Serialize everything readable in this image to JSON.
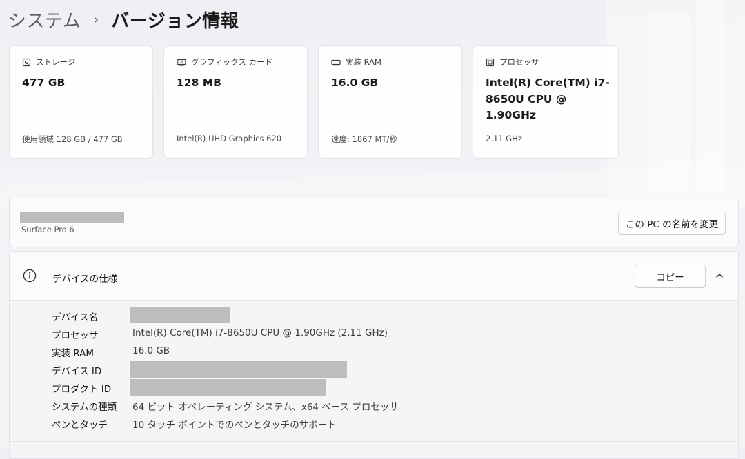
{
  "breadcrumb": {
    "parent": "システム",
    "separator": "›",
    "current": "バージョン情報"
  },
  "cards": [
    {
      "icon": "storage-icon",
      "label": "ストレージ",
      "value": "477 GB",
      "sub": "使用領域 128 GB / 477 GB"
    },
    {
      "icon": "graphics-card-icon",
      "label": "グラフィックス カード",
      "value": "128 MB",
      "sub": "Intel(R) UHD Graphics 620"
    },
    {
      "icon": "ram-icon",
      "label": "実装 RAM",
      "value": "16.0 GB",
      "sub": "速度: 1867 MT/秒"
    },
    {
      "icon": "processor-icon",
      "label": "プロセッサ",
      "value": "Intel(R) Core(TM) i7-8650U CPU @ 1.90GHz",
      "sub": "2.11 GHz"
    }
  ],
  "device": {
    "name_redacted": true,
    "model": "Surface Pro 6",
    "rename_button": "この PC の名前を変更"
  },
  "specs": {
    "title": "デバイスの仕様",
    "copy_button": "コピー",
    "rows": [
      {
        "label": "デバイス名",
        "value": "",
        "redacted": true
      },
      {
        "label": "プロセッサ",
        "value": "Intel(R) Core(TM) i7-8650U CPU @ 1.90GHz   (2.11 GHz)"
      },
      {
        "label": "実装 RAM",
        "value": "16.0 GB"
      },
      {
        "label": "デバイス ID",
        "value": "",
        "redacted": true
      },
      {
        "label": "プロダクト ID",
        "value": "",
        "redacted": true
      },
      {
        "label": "システムの種類",
        "value": "64 ビット オペレーティング システム、x64 ベース プロセッサ"
      },
      {
        "label": "ペンとタッチ",
        "value": "10 タッチ ポイントでのペンとタッチのサポート"
      }
    ]
  },
  "colors": {
    "background": "#f2f3f6",
    "card": "#ffffff",
    "redaction": "#bdbdbd",
    "text_primary": "#1a1a1a",
    "text_secondary": "#4a4a4a"
  }
}
